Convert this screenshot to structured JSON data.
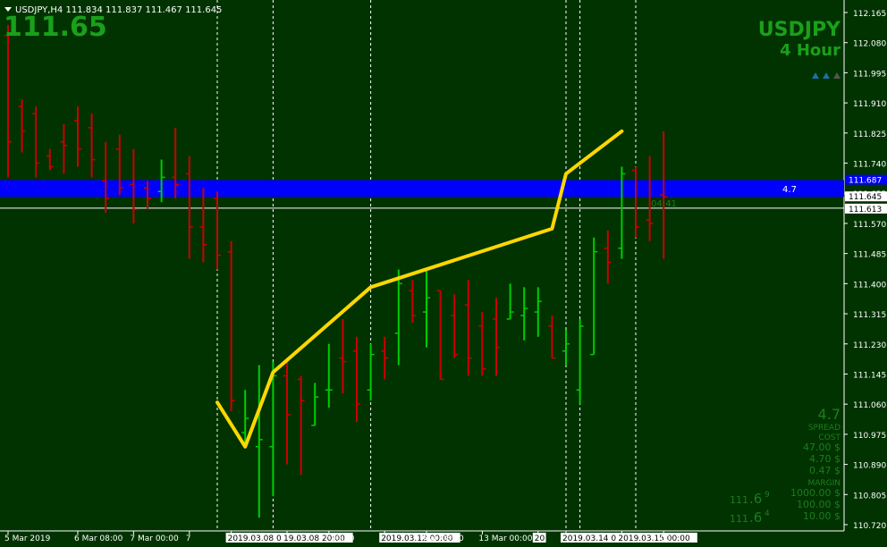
{
  "window": {
    "symbol_header": "USDJPY,H4  111.834 111.837 111.467 111.645",
    "big_price": "111.65",
    "symbol_name": "USDJPY",
    "timeframe": "4 Hour"
  },
  "spread_band": {
    "label": "4.7",
    "price_label": "111.687"
  },
  "crosshair": {
    "price_label": "111.613",
    "countdown_label": "04:41"
  },
  "current_price_label": "111.645",
  "info_panel": {
    "spread_value": "4.7",
    "spread_label": "SPREAD",
    "cost_label": "COST",
    "cost_values": [
      "47.00 $",
      "4.70 $",
      "0.47 $"
    ],
    "margin_label": "MARGIN",
    "margin_values": [
      "1000.00 $",
      "100.00 $",
      "10.00 $"
    ],
    "bid_main": "111",
    "bid_big": ".6",
    "bid_small": "9",
    "ask_main": "111",
    "ask_big": ".6",
    "ask_small": "4"
  },
  "colors": {
    "background": "#003300",
    "bull": "#00cc00",
    "bear": "#cc0000",
    "zigzag": "#ffd700",
    "spread_band": "#0000ff",
    "text_dim": "#1f7a1f",
    "text_bright": "#1aa01a"
  },
  "chart_data": {
    "type": "bar",
    "symbol": "USDJPY",
    "timeframe": "H4",
    "ylim": [
      110.72,
      112.145
    ],
    "price_ticks": [
      "112.165",
      "112.080",
      "111.995",
      "111.910",
      "111.825",
      "111.740",
      "111.655",
      "111.570",
      "111.485",
      "111.400",
      "111.315",
      "111.230",
      "111.145",
      "111.060",
      "110.975",
      "110.890",
      "110.805",
      "110.720"
    ],
    "price_tick_values": [
      112.165,
      112.08,
      111.995,
      111.91,
      111.825,
      111.74,
      111.655,
      111.57,
      111.485,
      111.4,
      111.315,
      111.23,
      111.145,
      111.06,
      110.975,
      110.89,
      110.805,
      110.72
    ],
    "time_labels": [
      {
        "bar": 0,
        "text": "5 Mar 2019"
      },
      {
        "bar": 5,
        "text": "6 Mar 08:00"
      },
      {
        "bar": 9,
        "text": "7 Mar 00:00"
      },
      {
        "bar": 13,
        "text": "7"
      },
      {
        "bar": 16,
        "text": "2019.03.08 04:00",
        "boxed": true
      },
      {
        "bar": 20,
        "text": "19.03.08 20:00",
        "boxed": true
      },
      {
        "bar": 23,
        "text": "r 00:00"
      },
      {
        "bar": 27,
        "text": "2019.03.12 00:00",
        "boxed": true
      },
      {
        "bar": 30,
        "text": "Mar 08:00"
      },
      {
        "bar": 34,
        "text": "13 Mar 00:00"
      },
      {
        "bar": 38,
        "text": "20",
        "boxed": true
      },
      {
        "bar": 40,
        "text": "2019.03.14 08",
        "boxed": true
      },
      {
        "bar": 44,
        "text": "2019.03.15 00:00",
        "boxed": true
      },
      {
        "bar": 47,
        "text": "00"
      }
    ],
    "vlines": [
      15,
      19,
      26,
      40,
      41,
      45
    ],
    "spread_band": [
      111.645,
      111.692
    ],
    "crosshair_price": 111.613,
    "ohlc": [
      [
        112.1,
        112.13,
        111.7,
        111.8
      ],
      [
        111.9,
        111.92,
        111.77,
        111.83
      ],
      [
        111.88,
        111.9,
        111.7,
        111.74
      ],
      [
        111.76,
        111.78,
        111.72,
        111.73
      ],
      [
        111.8,
        111.85,
        111.71,
        111.79
      ],
      [
        111.86,
        111.9,
        111.73,
        111.78
      ],
      [
        111.84,
        111.88,
        111.7,
        111.75
      ],
      [
        111.69,
        111.8,
        111.6,
        111.64
      ],
      [
        111.78,
        111.82,
        111.65,
        111.67
      ],
      [
        111.68,
        111.78,
        111.57,
        111.61
      ],
      [
        111.67,
        111.69,
        111.61,
        111.64
      ],
      [
        111.66,
        111.75,
        111.63,
        111.7
      ],
      [
        111.7,
        111.84,
        111.64,
        111.68
      ],
      [
        111.71,
        111.76,
        111.47,
        111.56
      ],
      [
        111.56,
        111.67,
        111.46,
        111.51
      ],
      [
        111.64,
        111.66,
        111.44,
        111.48
      ],
      [
        111.49,
        111.52,
        111.04,
        111.07
      ],
      [
        110.98,
        111.1,
        110.94,
        111.02
      ],
      [
        110.94,
        111.17,
        110.74,
        110.96
      ],
      [
        110.94,
        111.18,
        110.8,
        111.14
      ],
      [
        111.14,
        111.19,
        110.89,
        111.03
      ],
      [
        111.13,
        111.14,
        110.86,
        111.07
      ],
      [
        111.0,
        111.12,
        111.0,
        111.08
      ],
      [
        111.1,
        111.23,
        111.05,
        111.1
      ],
      [
        111.19,
        111.3,
        111.09,
        111.18
      ],
      [
        111.21,
        111.25,
        111.01,
        111.06
      ],
      [
        111.1,
        111.23,
        111.07,
        111.2
      ],
      [
        111.21,
        111.25,
        111.13,
        111.19
      ],
      [
        111.26,
        111.44,
        111.17,
        111.4
      ],
      [
        111.38,
        111.41,
        111.29,
        111.31
      ],
      [
        111.32,
        111.44,
        111.22,
        111.36
      ],
      [
        111.38,
        111.38,
        111.13,
        111.13
      ],
      [
        111.31,
        111.37,
        111.19,
        111.2
      ],
      [
        111.34,
        111.41,
        111.14,
        111.19
      ],
      [
        111.28,
        111.32,
        111.14,
        111.16
      ],
      [
        111.3,
        111.36,
        111.14,
        111.22
      ],
      [
        111.3,
        111.4,
        111.3,
        111.32
      ],
      [
        111.31,
        111.39,
        111.24,
        111.33
      ],
      [
        111.32,
        111.39,
        111.25,
        111.35
      ],
      [
        111.28,
        111.31,
        111.19,
        111.19
      ],
      [
        111.21,
        111.27,
        111.17,
        111.23
      ],
      [
        111.1,
        111.3,
        111.06,
        111.28
      ],
      [
        111.2,
        111.53,
        111.2,
        111.49
      ],
      [
        111.5,
        111.55,
        111.4,
        111.46
      ],
      [
        111.5,
        111.73,
        111.47,
        111.71
      ],
      [
        111.72,
        111.73,
        111.53,
        111.56
      ],
      [
        111.58,
        111.76,
        111.52,
        111.57
      ],
      [
        111.65,
        111.83,
        111.47,
        111.645
      ]
    ],
    "zigzag": [
      {
        "bar": 15,
        "price": 111.065
      },
      {
        "bar": 17,
        "price": 110.94
      },
      {
        "bar": 19,
        "price": 111.15
      },
      {
        "bar": 26,
        "price": 111.39
      },
      {
        "bar": 39,
        "price": 111.555
      },
      {
        "bar": 40,
        "price": 111.71
      },
      {
        "bar": 44,
        "price": 111.83
      }
    ]
  }
}
